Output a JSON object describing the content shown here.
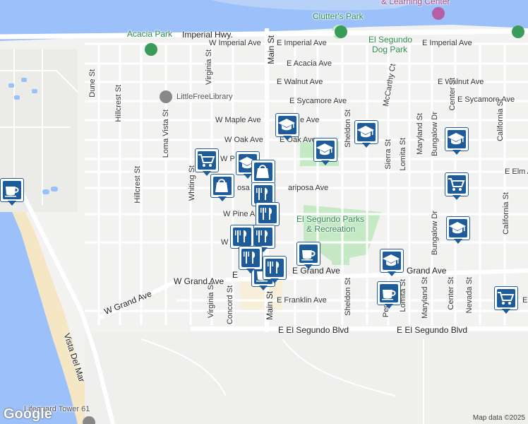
{
  "map": {
    "credit": "Map data ©2025",
    "logo": "Google",
    "colors": {
      "land": "#f2f2f0",
      "water": "#9cc0f9",
      "beach": "#f5e7c4",
      "park": "#c5e8c5",
      "road": "#ffffff",
      "marker": "#1e5c99"
    }
  },
  "places": {
    "clutters_park": "Clutter's Park",
    "learning_center": "& Learning Center",
    "acacia_park": "Acacia Park",
    "el_segundo_dog_park_1": "El Segundo",
    "el_segundo_dog_park_2": "Dog Park",
    "little_free_library": "LittleFreeLibrary",
    "parks_rec_1": "El Segundo Parks",
    "parks_rec_2": "& Recreation",
    "lifeguard_tower": "Lifeguard Tower 61"
  },
  "streets": {
    "imperial_hwy": "Imperial Hwy.",
    "w_imperial": "W Imperial Ave",
    "e_imperial_1": "E Imperial Ave",
    "e_imperial_2": "E Imperial Ave",
    "e_acacia": "E Acacia Ave",
    "e_walnut_1": "E Walnut Ave",
    "e_walnut_2": "E Walnut Ave",
    "e_sycamore_1": "E Sycamore Ave",
    "e_sycamore_2": "E Sycamore Ave",
    "w_maple": "W Maple Ave",
    "e_maple": "e Ave",
    "w_oak": "W Oak Ave",
    "e_oak": "E Oak Ave",
    "w_pine_short": "W P",
    "w_mariposa": "W",
    "w_mariposa2": "osa",
    "e_mariposa": "ariposa Ave",
    "e_elm": "E Elm A",
    "w_pine": "W Pine A",
    "w_holly": "W",
    "w_grand_1": "W Grand Ave",
    "w_grand_2": "W Grand Ave",
    "e_grand_1": "E Grand Ave",
    "e_grand_2": "Grand Ave",
    "e_el": "E",
    "e_franklin": "E Franklin Ave",
    "e_fra": "E Fra",
    "e_el_segundo_1": "E El Segundo Blvd",
    "e_el_segundo_2": "E El Segundo Blvd",
    "vista_del_mar": "Vista Del Mar",
    "main_st_n": "Main St",
    "main_st_s": "Main St",
    "dune_st": "Dune St",
    "hillcrest_n": "Hillcrest St",
    "hillcrest_s": "Hillcrest St",
    "loma_vista": "Loma Vista St",
    "virginia_n": "Virginia St",
    "virginia_s": "Virginia St",
    "whiting": "Whiting St",
    "concord": "Concord St",
    "sheldon_n": "Sheldon St",
    "sheldon_s": "Sheldon St",
    "mccarthy": "McCarthy Ct",
    "lomita_n": "Lomita St",
    "lomita_s": "Lomita St",
    "sierra": "Sierra St",
    "maryland_n": "Maryland St",
    "maryland_s": "Maryland St",
    "bungalow_n": "Bungalow Dr",
    "bungalow_s": "Bungalow Dr",
    "center_n": "Center St",
    "center_s": "Center St",
    "california_n": "California St",
    "california_s": "California St",
    "nevada": "Nevada St",
    "penn": "Penn St"
  },
  "markers": [
    {
      "type": "school",
      "icon": "graduation-cap-icon"
    },
    {
      "type": "school",
      "icon": "graduation-cap-icon"
    },
    {
      "type": "school",
      "icon": "graduation-cap-icon"
    },
    {
      "type": "school",
      "icon": "graduation-cap-icon"
    },
    {
      "type": "school",
      "icon": "graduation-cap-icon"
    },
    {
      "type": "school",
      "icon": "graduation-cap-icon"
    },
    {
      "type": "school",
      "icon": "graduation-cap-icon"
    },
    {
      "type": "grocery",
      "icon": "shopping-cart-icon"
    },
    {
      "type": "grocery",
      "icon": "shopping-cart-icon"
    },
    {
      "type": "grocery",
      "icon": "shopping-cart-icon"
    },
    {
      "type": "shopping",
      "icon": "shopping-bag-icon"
    },
    {
      "type": "shopping",
      "icon": "shopping-bag-icon"
    },
    {
      "type": "cafe",
      "icon": "coffee-cup-icon"
    },
    {
      "type": "cafe",
      "icon": "coffee-cup-icon"
    },
    {
      "type": "cafe",
      "icon": "coffee-cup-icon"
    },
    {
      "type": "cafe",
      "icon": "coffee-cup-icon"
    },
    {
      "type": "restaurant",
      "icon": "restaurant-icon"
    },
    {
      "type": "restaurant",
      "icon": "restaurant-icon"
    },
    {
      "type": "restaurant",
      "icon": "restaurant-icon"
    },
    {
      "type": "restaurant",
      "icon": "restaurant-icon"
    },
    {
      "type": "restaurant",
      "icon": "restaurant-icon"
    },
    {
      "type": "restaurant",
      "icon": "restaurant-icon"
    }
  ]
}
